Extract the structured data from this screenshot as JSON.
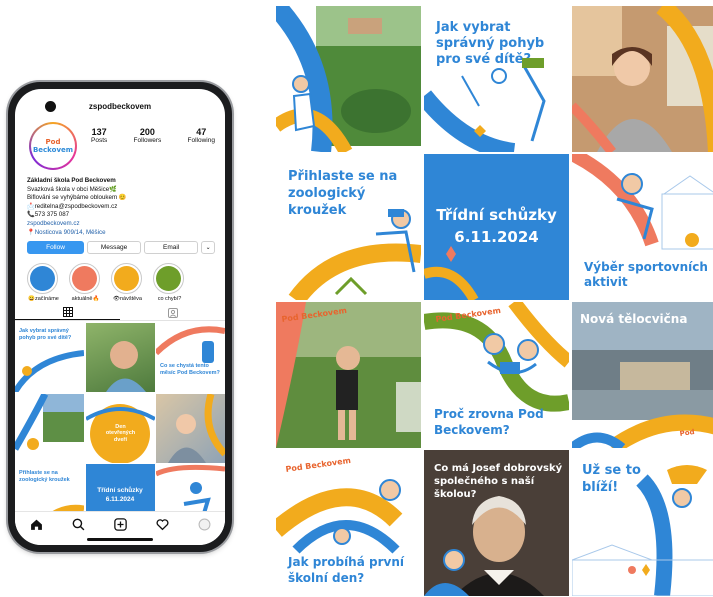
{
  "phone": {
    "username": "zspodbeckovem",
    "avatar_logo_top": "Pod",
    "avatar_logo_bottom": "Beckovem",
    "stats": [
      {
        "num": "137",
        "label": "Posts"
      },
      {
        "num": "200",
        "label": "Followers"
      },
      {
        "num": "47",
        "label": "Following"
      }
    ],
    "bio": {
      "name": "Základní škola Pod Beckovem",
      "line1": "Svazková škola v obci Měšice🌿",
      "line2": "Bifloväni se vyhýbáme obloukem 😊",
      "line3": "📩reditelna@zspodbeckovem.cz",
      "line4": "📞573 375 087",
      "link": "zspodbeckovem.cz",
      "address": "📍Nosticova 909/14, Měšice"
    },
    "buttons": {
      "follow": "Follow",
      "message": "Message",
      "email": "Email",
      "more": "⌄"
    },
    "stories": [
      {
        "label": "😀začínáme",
        "color": "#2f86d6"
      },
      {
        "label": "aktuálně🔥",
        "color": "#ef7a5f"
      },
      {
        "label": "👁návštěva",
        "color": "#f2ab1d"
      },
      {
        "label": "co chybí?",
        "color": "#6e9e2a"
      }
    ],
    "grid_texts": {
      "g1": "Jak vybrat správný pohyb pro své dítě?",
      "g3": "Co se chystá tento měsíc Pod Beckovem?",
      "g5": "Den otevřených dveří",
      "g7": "Přihlaste se na zoologický kroužek",
      "g8_line1": "Třídní schůzky",
      "g8_line2": "6.11.2024"
    }
  },
  "feed": {
    "tile_pohyb": "Jak vybrat správný pohyb pro své dítě?",
    "tile_krouzek": "Přihlaste se na zoologický kroužek",
    "tile_schuzky_title": "Třídní schůzky",
    "tile_schuzky_date": "6.11.2024",
    "tile_sport": "Výběr sportovních aktivit",
    "tile_proc": "Proč zrovna Pod Beckovem?",
    "tile_telocvicna": "Nová tělocvična",
    "tile_prvni": "Jak probíhá první školní den?",
    "tile_komensky": "Co má Josef dobrovský společného s naší školou?",
    "tile_blizi": "Už se to blíží!",
    "logo_top": "Pod",
    "logo_bottom": "Beckovem",
    "logo_small": "ZŠ Pod Beckovem"
  },
  "colors": {
    "blue": "#2f86d6",
    "orange": "#f2ab1d",
    "coral": "#ef7a5f",
    "green": "#6e9e2a",
    "instagram_blue": "#3797f0"
  }
}
